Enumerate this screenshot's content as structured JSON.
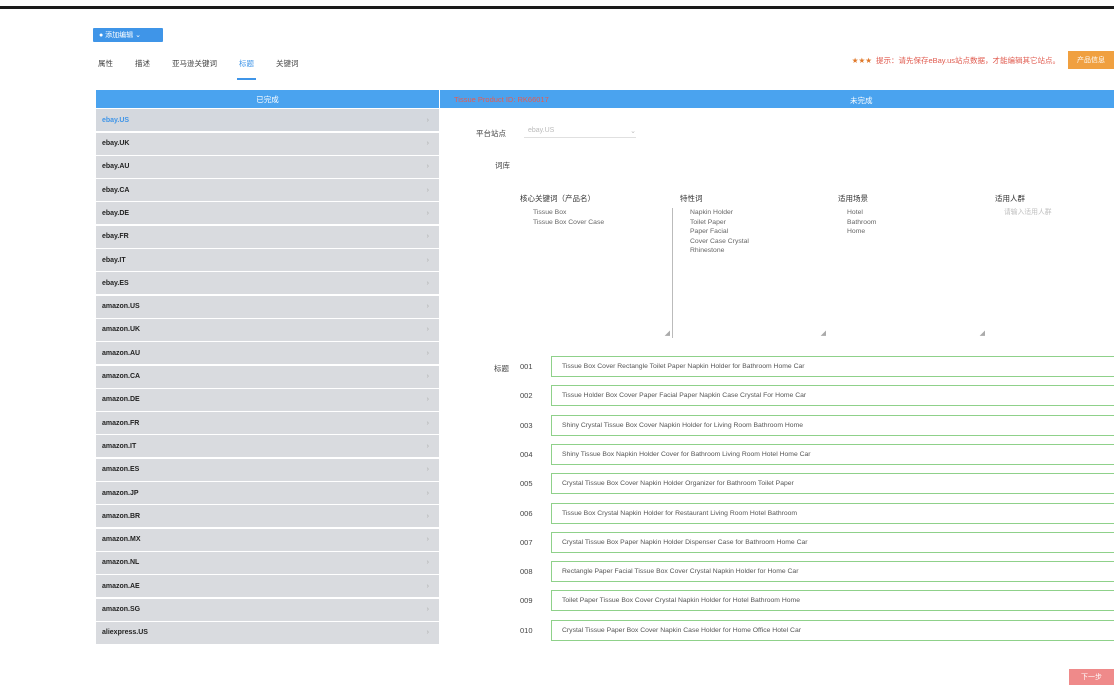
{
  "dropdown_label": "● 添加编辑 ⌄",
  "tabs": [
    "属性",
    "描述",
    "亚马逊关键词",
    "标题",
    "关键词"
  ],
  "active_tab": 3,
  "hint": {
    "stars": "★★★",
    "text": "提示：请先保存eBay.us站点数据，才能编辑其它站点。",
    "button": "产品信息"
  },
  "left_panel": {
    "header": "已完成",
    "sites": [
      "ebay.US",
      "ebay.UK",
      "ebay.AU",
      "ebay.CA",
      "ebay.DE",
      "ebay.FR",
      "ebay.IT",
      "ebay.ES",
      "amazon.US",
      "amazon.UK",
      "amazon.AU",
      "amazon.CA",
      "amazon.DE",
      "amazon.FR",
      "amazon.IT",
      "amazon.ES",
      "amazon.JP",
      "amazon.BR",
      "amazon.MX",
      "amazon.NL",
      "amazon.AE",
      "amazon.SG",
      "aliexpress.US"
    ],
    "selected": 0
  },
  "right_panel": {
    "product": "Tissue Product ID: RK66017",
    "header": "未完成",
    "site_label": "平台站点",
    "site_value": "ebay.US",
    "words_label": "词库",
    "columns": [
      {
        "title": "核心关键词（产品名）",
        "items": [
          "Tissue Box",
          "Tissue Box Cover Case"
        ]
      },
      {
        "title": "特性词",
        "items": [
          "Napkin Holder",
          "Toilet Paper",
          "Paper Facial",
          "Cover Case Crystal",
          "Rhinestone"
        ]
      },
      {
        "title": "适用场景",
        "items": [
          "Hotel",
          "Bathroom",
          "Home"
        ]
      },
      {
        "title": "适用人群",
        "items": [
          "请输入适用人群"
        ]
      }
    ],
    "titles_label": "标题",
    "titles": [
      {
        "num": "001",
        "text": "Tissue Box Cover Rectangle Toilet Paper Napkin Holder for Bathroom Home Car"
      },
      {
        "num": "002",
        "text": "Tissue Holder Box Cover Paper Facial Paper Napkin Case Crystal For Home Car"
      },
      {
        "num": "003",
        "text": "Shiny Crystal Tissue Box Cover Napkin Holder for Living Room Bathroom Home"
      },
      {
        "num": "004",
        "text": "Shiny Tissue Box Napkin Holder Cover for Bathroom Living Room Hotel Home Car"
      },
      {
        "num": "005",
        "text": "Crystal Tissue Box Cover Napkin Holder Organizer for Bathroom Toilet Paper"
      },
      {
        "num": "006",
        "text": "Tissue Box Crystal Napkin Holder for Restaurant Living Room Hotel Bathroom"
      },
      {
        "num": "007",
        "text": "Crystal Tissue Box Paper Napkin Holder Dispenser Case for Bathroom Home Car"
      },
      {
        "num": "008",
        "text": "Rectangle Paper Facial Tissue Box Cover Crystal Napkin Holder for Home Car"
      },
      {
        "num": "009",
        "text": "Toilet Paper Tissue Box Cover Crystal Napkin Holder for Hotel Bathroom Home"
      },
      {
        "num": "010",
        "text": "Crystal Tissue Paper Box Cover Napkin Case Holder for Home Office Hotel Car"
      }
    ]
  },
  "next_button": "下一步"
}
